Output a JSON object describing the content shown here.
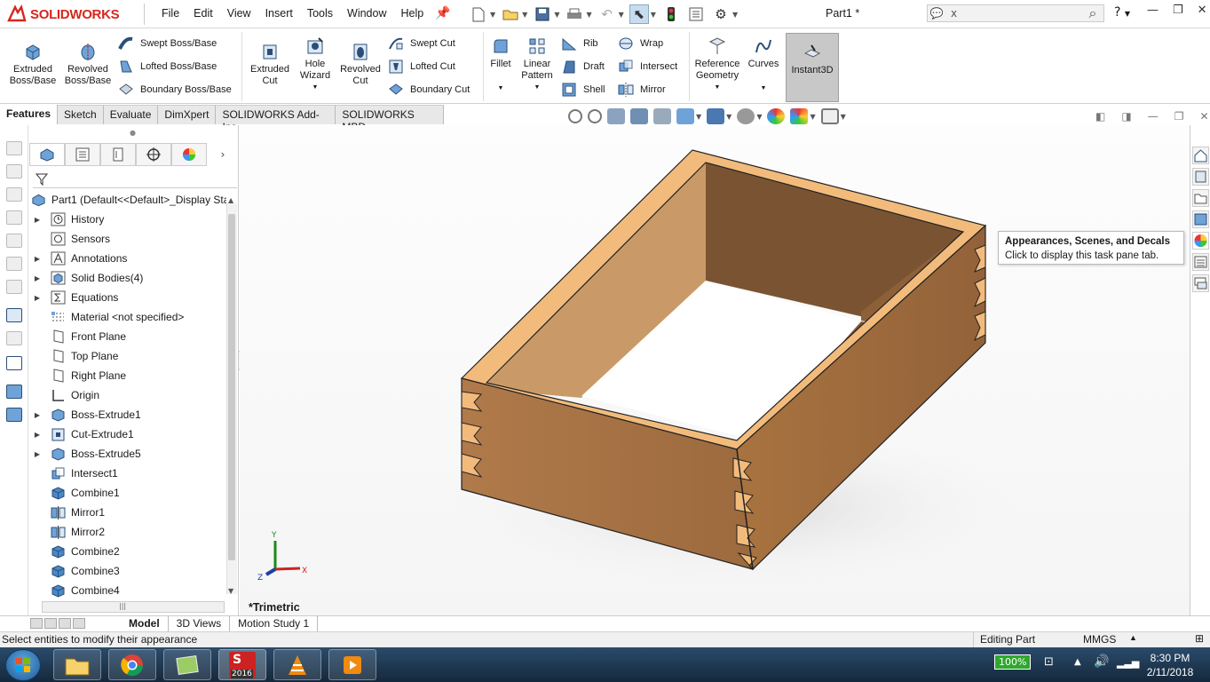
{
  "app": {
    "brand": "SOLIDWORKS",
    "document_title": "Part1 *"
  },
  "menu": [
    "File",
    "Edit",
    "View",
    "Insert",
    "Tools",
    "Window",
    "Help"
  ],
  "search": {
    "value": "x"
  },
  "help_label": "?",
  "window_controls": [
    "minimize",
    "restore",
    "close"
  ],
  "features": {
    "extruded_boss": "Extruded\nBoss/Base",
    "revolved_boss": "Revolved\nBoss/Base",
    "swept_boss": "Swept Boss/Base",
    "lofted_boss": "Lofted Boss/Base",
    "boundary_boss": "Boundary Boss/Base",
    "extruded_cut": "Extruded\nCut",
    "hole_wizard": "Hole\nWizard",
    "revolved_cut": "Revolved\nCut",
    "swept_cut": "Swept Cut",
    "lofted_cut": "Lofted Cut",
    "boundary_cut": "Boundary Cut",
    "fillet": "Fillet",
    "linear_pattern": "Linear\nPattern",
    "rib": "Rib",
    "draft": "Draft",
    "shell": "Shell",
    "wrap": "Wrap",
    "intersect": "Intersect",
    "mirror": "Mirror",
    "reference_geometry": "Reference\nGeometry",
    "curves": "Curves",
    "instant3d": "Instant3D"
  },
  "command_tabs": [
    {
      "label": "Features",
      "active": true
    },
    {
      "label": "Sketch"
    },
    {
      "label": "Evaluate"
    },
    {
      "label": "DimXpert"
    },
    {
      "label": "SOLIDWORKS Add-Ins"
    },
    {
      "label": "SOLIDWORKS MBD"
    }
  ],
  "tree": {
    "root": "Part1  (Default<<Default>_Display Sta",
    "items": [
      {
        "label": "History",
        "icon": "history-icon",
        "expandable": true
      },
      {
        "label": "Sensors",
        "icon": "sensors-icon"
      },
      {
        "label": "Annotations",
        "icon": "annotations-icon",
        "expandable": true
      },
      {
        "label": "Solid Bodies(4)",
        "icon": "solid-bodies-icon",
        "expandable": true
      },
      {
        "label": "Equations",
        "icon": "equations-icon",
        "expandable": true
      },
      {
        "label": "Material <not specified>",
        "icon": "material-icon"
      },
      {
        "label": "Front Plane",
        "icon": "plane-icon"
      },
      {
        "label": "Top Plane",
        "icon": "plane-icon"
      },
      {
        "label": "Right Plane",
        "icon": "plane-icon"
      },
      {
        "label": "Origin",
        "icon": "origin-icon"
      },
      {
        "label": "Boss-Extrude1",
        "icon": "boss-extrude-icon",
        "expandable": true
      },
      {
        "label": "Cut-Extrude1",
        "icon": "cut-extrude-icon",
        "expandable": true
      },
      {
        "label": "Boss-Extrude5",
        "icon": "boss-extrude-icon",
        "expandable": true
      },
      {
        "label": "Intersect1",
        "icon": "intersect-icon"
      },
      {
        "label": "Combine1",
        "icon": "combine-icon"
      },
      {
        "label": "Mirror1",
        "icon": "mirror-icon"
      },
      {
        "label": "Mirror2",
        "icon": "mirror-icon"
      },
      {
        "label": "Combine2",
        "icon": "combine-icon"
      },
      {
        "label": "Combine3",
        "icon": "combine-icon"
      },
      {
        "label": "Combine4",
        "icon": "combine-icon"
      }
    ]
  },
  "viewport": {
    "view_name": "*Trimetric",
    "triad": {
      "x": "X",
      "y": "Y",
      "z": "Z"
    }
  },
  "tooltip": {
    "title": "Appearances, Scenes, and Decals",
    "body": "Click to display this task pane tab."
  },
  "bottom_tabs": [
    "Model",
    "3D Views",
    "Motion Study 1"
  ],
  "status": {
    "message": "Select entities to modify their appearance",
    "mode": "Editing Part",
    "units": "MMGS"
  },
  "taskbar": {
    "battery": "100%",
    "time": "8:30 PM",
    "date": "2/11/2018",
    "sw_version": "2016"
  },
  "colors": {
    "brand_red": "#d7261e",
    "wood_face": "#c48a57",
    "wood_end": "#f0b97a",
    "taskbar": "#1f3a57"
  }
}
